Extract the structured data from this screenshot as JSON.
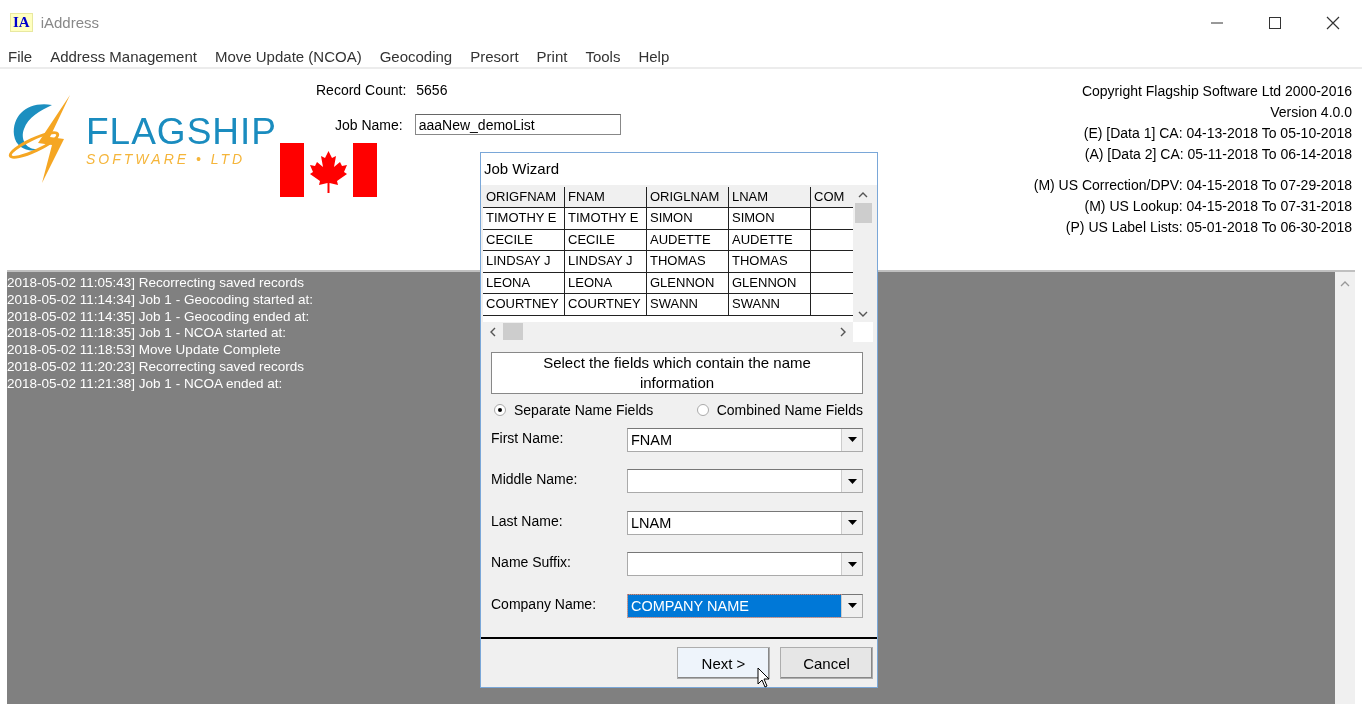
{
  "window": {
    "icon_text": "IA",
    "title": "iAddress"
  },
  "menu": [
    "File",
    "Address Management",
    "Move Update (NCOA)",
    "Geocoding",
    "Presort",
    "Print",
    "Tools",
    "Help"
  ],
  "header": {
    "logo": {
      "name": "FLAGSHIP",
      "tagline": "SOFTWARE • LTD"
    },
    "record_count_label": "Record Count:",
    "record_count": "5656",
    "job_name_label": "Job Name:",
    "job_name": "aaaNew_demoList",
    "info": [
      "Copyright Flagship Software Ltd 2000-2016",
      "Version 4.0.0",
      "(E) [Data 1] CA: 04-13-2018 To 05-10-2018",
      "(A) [Data 2] CA: 05-11-2018 To 06-14-2018"
    ],
    "us_info": [
      "(M) US Correction/DPV: 04-15-2018 To 07-29-2018",
      "(M) US Lookup: 04-15-2018 To 07-31-2018",
      "(P) US Label Lists: 05-01-2018 To 06-30-2018"
    ]
  },
  "log": [
    "2018-05-02 11:05:43] Recorrecting saved records",
    "2018-05-02 11:14:34] Job 1 - Geocoding started at:",
    "2018-05-02 11:14:35] Job 1 - Geocoding ended at:",
    "2018-05-02 11:18:35] Job 1 - NCOA started at:",
    "2018-05-02 11:18:53] Move Update Complete",
    "2018-05-02 11:20:23] Recorrecting saved records",
    "2018-05-02 11:21:38] Job 1 - NCOA ended at:"
  ],
  "dialog": {
    "title": "Job Wizard",
    "table": {
      "columns": [
        "ORIGFNAM",
        "FNAM",
        "ORIGLNAM",
        "LNAM",
        "COM"
      ],
      "rows": [
        [
          "TIMOTHY E",
          "TIMOTHY E",
          "SIMON",
          "SIMON",
          ""
        ],
        [
          "CECILE",
          "CECILE",
          "AUDETTE",
          "AUDETTE",
          ""
        ],
        [
          "LINDSAY J",
          "LINDSAY J",
          "THOMAS",
          "THOMAS",
          ""
        ],
        [
          "LEONA",
          "LEONA",
          "GLENNON",
          "GLENNON",
          ""
        ],
        [
          "COURTNEY",
          "COURTNEY",
          "SWANN",
          "SWANN",
          ""
        ]
      ]
    },
    "instruction": "Select the fields which contain the name information",
    "options": [
      {
        "label": "Separate Name Fields",
        "selected": true
      },
      {
        "label": "Combined Name Fields",
        "selected": false
      }
    ],
    "fields": [
      {
        "label": "First Name:",
        "value": "FNAM",
        "focused": false
      },
      {
        "label": "Middle Name:",
        "focused": false
      },
      {
        "label": "Last Name:",
        "value": "LNAM",
        "focused": false
      },
      {
        "label": "Name Suffix:",
        "focused": false
      },
      {
        "label": "Company Name:",
        "value": "COMPANY NAME",
        "focused": true
      }
    ],
    "buttons": [
      {
        "label": "Next >",
        "hovered": true
      },
      {
        "label": "Cancel",
        "hovered": false
      }
    ]
  }
}
